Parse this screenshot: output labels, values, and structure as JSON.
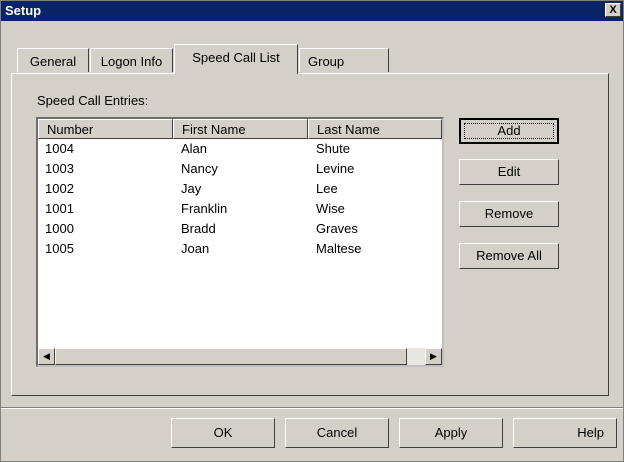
{
  "window": {
    "title": "Setup",
    "close_glyph": "X"
  },
  "tabs": [
    {
      "label": "General"
    },
    {
      "label": "Logon Info"
    },
    {
      "label": "Speed Call List"
    },
    {
      "label": "Group"
    }
  ],
  "section": {
    "label": "Speed Call Entries:",
    "columns": [
      "Number",
      "First Name",
      "Last Name"
    ],
    "rows": [
      [
        "1004",
        "Alan",
        "Shute"
      ],
      [
        "1003",
        "Nancy",
        "Levine"
      ],
      [
        "1002",
        "Jay",
        "Lee"
      ],
      [
        "1001",
        "Franklin",
        "Wise"
      ],
      [
        "1000",
        "Bradd",
        "Graves"
      ],
      [
        "1005",
        "Joan",
        "Maltese"
      ]
    ]
  },
  "actions": {
    "add": "Add",
    "edit": "Edit",
    "remove": "Remove",
    "remove_all": "Remove All"
  },
  "footer": {
    "ok": "OK",
    "cancel": "Cancel",
    "apply": "Apply",
    "help": "Help"
  }
}
